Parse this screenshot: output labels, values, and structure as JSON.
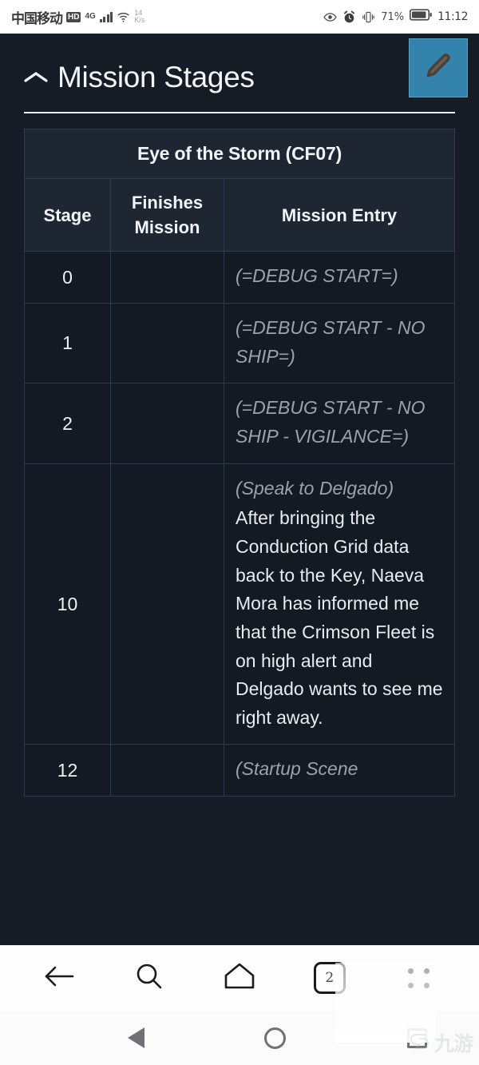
{
  "status_bar": {
    "carrier": "中国移动",
    "hd_badge": "HD",
    "network_type": "4G",
    "data_speed_value": "14",
    "data_speed_unit": "K/s",
    "icons": [
      "eye-icon",
      "alarm-clock-icon",
      "vibrate-icon",
      "battery-icon"
    ],
    "battery_percent": "71%",
    "clock": "11:12"
  },
  "page": {
    "section": {
      "title": "Mission Stages",
      "collapse_icon": "chevron-up-icon",
      "edit_icon": "pencil-icon",
      "edit_accent_color": "#3383ac"
    },
    "table": {
      "caption": "Eye of the Storm (CF07)",
      "columns": [
        "Stage",
        "Finishes Mission",
        "Mission Entry"
      ],
      "rows": [
        {
          "stage": "0",
          "finishes": "",
          "note": "(=DEBUG START=)",
          "body": ""
        },
        {
          "stage": "1",
          "finishes": "",
          "note": "(=DEBUG START - NO SHIP=)",
          "body": ""
        },
        {
          "stage": "2",
          "finishes": "",
          "note": "(=DEBUG START - NO SHIP - VIGILANCE=)",
          "body": ""
        },
        {
          "stage": "10",
          "finishes": "",
          "note": "(Speak to Delgado)",
          "body": "After bringing the Conduction Grid data back to the Key, Naeva Mora has informed me that the Crimson Fleet is on high alert and Delgado wants to see me right away."
        },
        {
          "stage": "12",
          "finishes": "",
          "note": "(Startup Scene",
          "body": ""
        }
      ]
    }
  },
  "browser_bar": {
    "back_label": "back-arrow-icon",
    "search_label": "search-icon",
    "home_label": "home-icon",
    "tab_count": "2",
    "menu_label": "more-menu-icon"
  },
  "nav_bar": {
    "back": "nav-back-triangle-icon",
    "home": "nav-home-circle-icon",
    "recents": "nav-recents-square-icon"
  },
  "watermark": {
    "text": "九游"
  }
}
